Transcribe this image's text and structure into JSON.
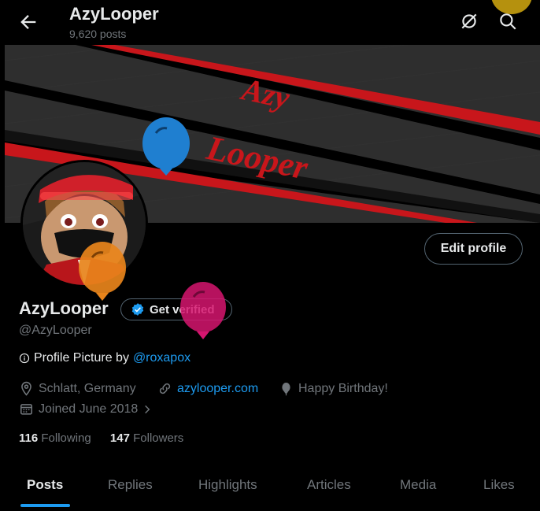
{
  "header": {
    "title": "AzyLooper",
    "posts_count": "9,620 posts"
  },
  "banner": {
    "text_line1": "Azy",
    "text_line2": "Looper"
  },
  "profile": {
    "edit_label": "Edit profile",
    "name": "AzyLooper",
    "get_verified": "Get verified",
    "handle": "@AzyLooper",
    "bio_prefix": "Profile Picture by",
    "bio_link": "@roxapox",
    "location": "Schlatt, Germany",
    "website": "azylooper.com",
    "birthday": "Happy Birthday!",
    "joined": "Joined June 2018"
  },
  "stats": {
    "following_count": "116",
    "following_label": "Following",
    "followers_count": "147",
    "followers_label": "Followers"
  },
  "tabs": [
    "Posts",
    "Replies",
    "Highlights",
    "Articles",
    "Media",
    "Likes"
  ],
  "colors": {
    "accent": "#1d9bf0",
    "banner_red": "#c8161b",
    "balloon_blue": "#1f7fd0",
    "balloon_orange": "#e8841b",
    "balloon_pink": "#d6156f",
    "balloon_gold": "#c9a10f"
  }
}
